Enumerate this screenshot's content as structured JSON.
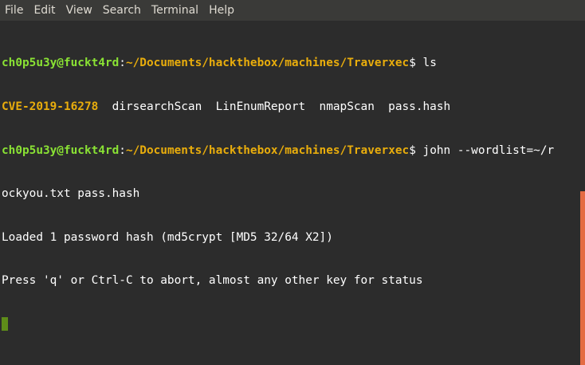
{
  "menubar": {
    "items": [
      "File",
      "Edit",
      "View",
      "Search",
      "Terminal",
      "Help"
    ]
  },
  "terminal": {
    "prompt": {
      "user": "ch0p5u3y@fuckt4rd",
      "colon": ":",
      "path": "~/Documents/hackthebox/machines/Traverxec",
      "dollar": "$ "
    },
    "cmd1": "ls",
    "ls_output": {
      "cve": "CVE-2019-16278",
      "rest": "  dirsearchScan  LinEnumReport  nmapScan  pass.hash"
    },
    "cmd2_part1": "john --wordlist=~/r",
    "cmd2_part2": "ockyou.txt pass.hash",
    "out1": "Loaded 1 password hash (md5crypt [MD5 32/64 X2])",
    "out2": "Press 'q' or Ctrl-C to abort, almost any other key for status"
  },
  "colors": {
    "background": "#2c2c2c",
    "menubar": "#3a3a38",
    "prompt_user": "#8ae234",
    "prompt_path": "#e9ad0c",
    "cursor": "#5e8c19",
    "scrollbar": "#e46b43"
  }
}
